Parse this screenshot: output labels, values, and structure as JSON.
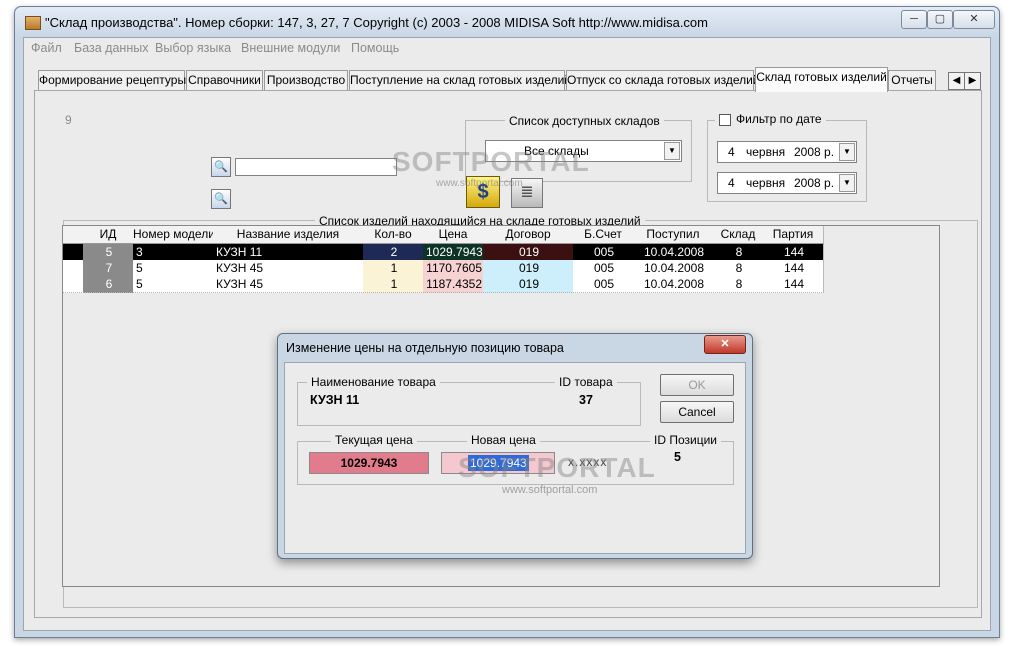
{
  "window": {
    "title": "\"Склад производства\". Номер сборки: 147, 3, 27, 7     Copyright (c) 2003 - 2008 MIDISA Soft http://www.midisa.com",
    "minimize": "─",
    "maximize": "▢",
    "close": "✕"
  },
  "menu": [
    "Файл",
    "База данных",
    "Выбор языка",
    "Внешние модули",
    "Помощь"
  ],
  "tabs": [
    "Формирование рецептуры",
    "Справочники",
    "Производство",
    "Поступление на склад готовых изделий",
    "Отпуск со склада готовых изделий",
    "Склад готовых изделий",
    "Отчеты"
  ],
  "tab_scroll": {
    "left": "◀",
    "right": "▶"
  },
  "panel": {
    "counter": "9",
    "warehouses_title": "Список доступных складов",
    "warehouse_selected": "Все склады",
    "date_filter_label": "Фильтр по дате",
    "date_from": {
      "day": "4",
      "month": "червня",
      "year": "2008 р."
    },
    "date_to": {
      "day": "4",
      "month": "червня",
      "year": "2008 р."
    },
    "list_title": "Список изделий находящийся на складе готовых изделий"
  },
  "table": {
    "columns": [
      "ИД",
      "Номер модели",
      "Название изделия",
      "Кол-во",
      "Цена",
      "Договор",
      "Б.Счет",
      "Поступил",
      "Склад",
      "Партия"
    ],
    "rows": [
      [
        "5",
        "3",
        "КУЗН 11",
        "2",
        "1029.7943",
        "019",
        "005",
        "10.04.2008",
        "8",
        "144"
      ],
      [
        "7",
        "5",
        "КУЗН 45",
        "1",
        "1170.7605",
        "019",
        "005",
        "10.04.2008",
        "8",
        "144"
      ],
      [
        "6",
        "5",
        "КУЗН 45",
        "1",
        "1187.4352",
        "019",
        "005",
        "10.04.2008",
        "8",
        "144"
      ]
    ]
  },
  "dialog": {
    "title": "Изменение цены на отдельную позицию товара",
    "close": "✕",
    "name_label": "Наименование товара",
    "name_value": "КУЗН 11",
    "id_label": "ID товара",
    "id_value": "37",
    "ok": "OK",
    "cancel": "Cancel",
    "current_price_label": "Текущая цена",
    "current_price_value": "1029.7943",
    "new_price_label": "Новая цена",
    "new_price_value": "1029.7943",
    "mask": "x.xxxx",
    "position_label": "ID Позиции",
    "position_value": "5"
  },
  "watermark": {
    "brand": "SOFTPORTAL",
    "small": "www.softportal.com"
  },
  "colors": {
    "selected_row_bg": "#000000",
    "qty_bg": "#fbf3d6",
    "price_bg": "#f7d2d2",
    "contract_bg": "#cdeefb",
    "current_price_bg": "#e27b8c"
  }
}
